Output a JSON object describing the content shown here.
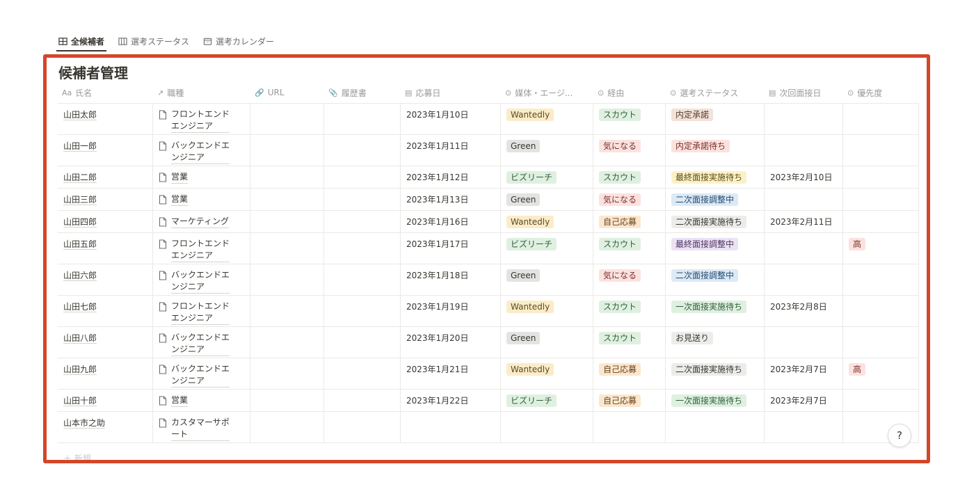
{
  "tabs": [
    {
      "label": "全候補者",
      "icon": "table-icon",
      "active": true
    },
    {
      "label": "選考ステータス",
      "icon": "board-icon",
      "active": false
    },
    {
      "label": "選考カレンダー",
      "icon": "calendar-icon",
      "active": false
    }
  ],
  "title": "候補者管理",
  "columns": [
    {
      "label": "氏名",
      "icon": "Aa"
    },
    {
      "label": "職種",
      "icon": "↗"
    },
    {
      "label": "URL",
      "icon": "🔗"
    },
    {
      "label": "履歴書",
      "icon": "📎"
    },
    {
      "label": "応募日",
      "icon": "▤"
    },
    {
      "label": "媒体・エージ...",
      "icon": "⊙"
    },
    {
      "label": "経由",
      "icon": "⊙"
    },
    {
      "label": "選考ステータス",
      "icon": "⊙"
    },
    {
      "label": "次回面接日",
      "icon": "▤"
    },
    {
      "label": "優先度",
      "icon": "⊙"
    }
  ],
  "rows": [
    {
      "name": "山田太郎",
      "job": "フロントエンドエンジニア",
      "date": "2023年1月10日",
      "media": "Wantedly",
      "via": "スカウト",
      "status": "内定承諾",
      "next": "",
      "priority": ""
    },
    {
      "name": "山田一郎",
      "job": "バックエンドエンジニア",
      "date": "2023年1月11日",
      "media": "Green",
      "via": "気になる",
      "status": "内定承諾待ち",
      "next": "",
      "priority": ""
    },
    {
      "name": "山田二郎",
      "job": "営業",
      "date": "2023年1月12日",
      "media": "ビズリーチ",
      "via": "スカウト",
      "status": "最終面接実施待ち",
      "next": "2023年2月10日",
      "priority": ""
    },
    {
      "name": "山田三郎",
      "job": "営業",
      "date": "2023年1月13日",
      "media": "Green",
      "via": "気になる",
      "status": "二次面接調整中",
      "next": "",
      "priority": ""
    },
    {
      "name": "山田四郎",
      "job": "マーケティング",
      "date": "2023年1月16日",
      "media": "Wantedly",
      "via": "自己応募",
      "status": "二次面接実施待ち",
      "next": "2023年2月11日",
      "priority": ""
    },
    {
      "name": "山田五郎",
      "job": "フロントエンドエンジニア",
      "date": "2023年1月17日",
      "media": "ビズリーチ",
      "via": "スカウト",
      "status": "最終面接調整中",
      "next": "",
      "priority": "高"
    },
    {
      "name": "山田六郎",
      "job": "バックエンドエンジニア",
      "date": "2023年1月18日",
      "media": "Green",
      "via": "気になる",
      "status": "二次面接調整中",
      "next": "",
      "priority": ""
    },
    {
      "name": "山田七郎",
      "job": "フロントエンドエンジニア",
      "date": "2023年1月19日",
      "media": "Wantedly",
      "via": "スカウト",
      "status": "一次面接実施待ち",
      "next": "2023年2月8日",
      "priority": ""
    },
    {
      "name": "山田八郎",
      "job": "バックエンドエンジニア",
      "date": "2023年1月20日",
      "media": "Green",
      "via": "スカウト",
      "status": "お見送り",
      "next": "",
      "priority": ""
    },
    {
      "name": "山田九郎",
      "job": "バックエンドエンジニア",
      "date": "2023年1月21日",
      "media": "Wantedly",
      "via": "自己応募",
      "status": "二次面接実施待ち",
      "next": "2023年2月7日",
      "priority": "高"
    },
    {
      "name": "山田十郎",
      "job": "営業",
      "date": "2023年1月22日",
      "media": "ビズリーチ",
      "via": "自己応募",
      "status": "一次面接実施待ち",
      "next": "2023年2月7日",
      "priority": ""
    },
    {
      "name": "山本市之助",
      "job": "カスタマーサポート",
      "date": "",
      "media": "",
      "via": "",
      "status": "",
      "next": "",
      "priority": ""
    }
  ],
  "tag_colors": {
    "Wantedly": {
      "bg": "#fbecc9",
      "fg": "#5c4a1e"
    },
    "Green": {
      "bg": "#e3e3e1",
      "fg": "#37352f"
    },
    "ビズリーチ": {
      "bg": "#dff0e0",
      "fg": "#2f5e3a"
    },
    "スカウト": {
      "bg": "#dff0e0",
      "fg": "#2f5e3a"
    },
    "気になる": {
      "bg": "#fbe2df",
      "fg": "#7a2e28"
    },
    "自己応募": {
      "bg": "#fbe7cf",
      "fg": "#6b4317"
    },
    "内定承諾": {
      "bg": "#f1e2da",
      "fg": "#5a3b2c"
    },
    "内定承諾待ち": {
      "bg": "#fbe2df",
      "fg": "#7a2e28"
    },
    "最終面接実施待ち": {
      "bg": "#fbf1c8",
      "fg": "#5d4c10"
    },
    "二次面接調整中": {
      "bg": "#dde9f5",
      "fg": "#1f4b70"
    },
    "二次面接実施待ち": {
      "bg": "#ececea",
      "fg": "#37352f"
    },
    "最終面接調整中": {
      "bg": "#ebe2f3",
      "fg": "#4f3364"
    },
    "一次面接実施待ち": {
      "bg": "#dff0e0",
      "fg": "#2f5e3a"
    },
    "お見送り": {
      "bg": "#ececea",
      "fg": "#37352f"
    },
    "高": {
      "bg": "#fbe2df",
      "fg": "#7a2e28"
    }
  },
  "new_row_label": "＋ 新規",
  "help_label": "?"
}
